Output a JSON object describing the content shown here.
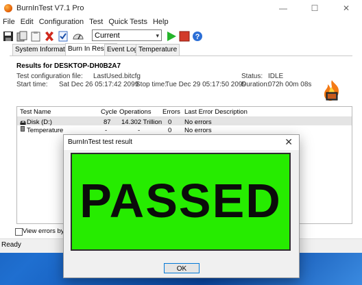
{
  "window": {
    "title": "BurnInTest V7.1 Pro",
    "minimize": "—",
    "maximize": "☐",
    "close": "✕"
  },
  "menu": [
    "File",
    "Edit",
    "Configuration",
    "Test",
    "Quick Tests",
    "Help"
  ],
  "toolbar": {
    "config_value": "Current configuration"
  },
  "tabs": [
    "System Information",
    "Burn In Results",
    "Event Log",
    "Temperature"
  ],
  "results": {
    "title": "Results for DESKTOP-DH0B2A7",
    "config_file_label": "Test configuration file:",
    "config_file": "LastUsed.bitcfg",
    "start_label": "Start time:",
    "start_time": "Sat Dec 26 05:17:42 2099",
    "stop_label": "Stop time:",
    "stop_time": "Tue Dec 29 05:17:50 2099",
    "status_label": "Status:",
    "status": "IDLE",
    "duration_label": "Duration:",
    "duration": "072h 00m 08s"
  },
  "table": {
    "headers": [
      "Test Name",
      "Cycle",
      "Operations",
      "Errors",
      "Last Error Description"
    ],
    "rows": [
      [
        "Disk (D:)",
        "87",
        "14.302 Trillion",
        "0",
        "No errors"
      ],
      [
        "Temperature",
        "-",
        "-",
        "0",
        "No errors"
      ]
    ]
  },
  "checkbox_label": "View errors by categ",
  "status_bar": "Ready",
  "dialog": {
    "title": "BurnInTest test result",
    "close": "✕",
    "result": "PASSED",
    "result_color": "#26ec00",
    "ok": "OK"
  }
}
